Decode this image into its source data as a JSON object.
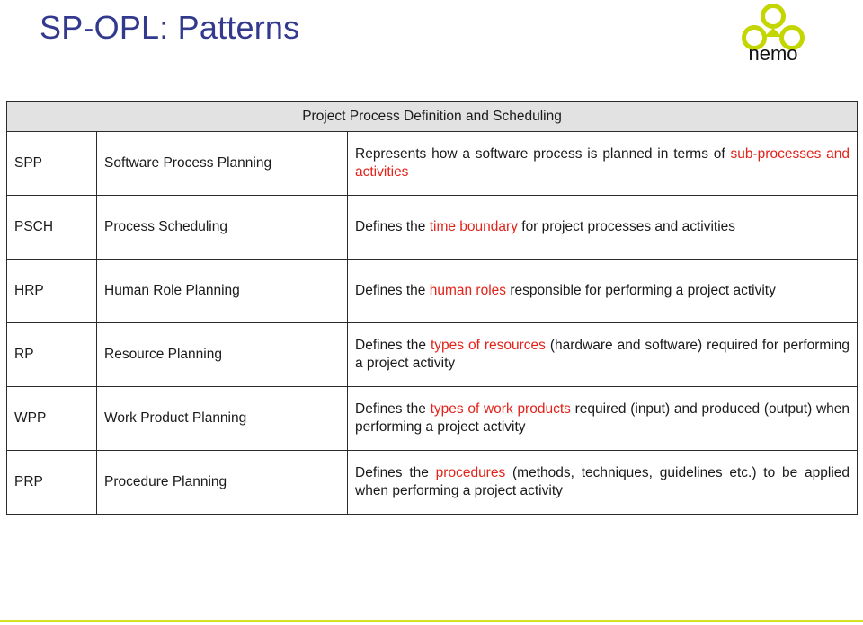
{
  "slide": {
    "title": "SP-OPL: Patterns",
    "title_color": "#333a8e",
    "accent_color": "#d7e021",
    "highlight_color": "#e2231a",
    "bottom_rule_color": "#d7e021"
  },
  "logo": {
    "name": "nemo",
    "wordmark": "nemo",
    "mark_color": "#c3d600",
    "wordmark_color": "#111111"
  },
  "table": {
    "header": "Project Process Definition and Scheduling",
    "header_bg": "#e2e2e2",
    "rows": [
      {
        "abbr": "SPP",
        "name": "Software Process Planning",
        "desc_parts": [
          {
            "text": "Represents how a software process is planned in terms of ",
            "highlight": false
          },
          {
            "text": "sub-processes and activities",
            "highlight": true
          }
        ],
        "desc_plain": "Represents how a software process is planned in terms of sub-processes and activities"
      },
      {
        "abbr": "PSCH",
        "name": "Process Scheduling",
        "desc_parts": [
          {
            "text": "Defines the ",
            "highlight": false
          },
          {
            "text": "time boundary",
            "highlight": true
          },
          {
            "text": " for project processes and activities",
            "highlight": false
          }
        ],
        "desc_plain": "Defines the time boundary for project processes and activities"
      },
      {
        "abbr": "HRP",
        "name": "Human Role Planning",
        "desc_parts": [
          {
            "text": "Defines the ",
            "highlight": false
          },
          {
            "text": "human roles",
            "highlight": true
          },
          {
            "text": " responsible for performing a project activity",
            "highlight": false
          }
        ],
        "desc_plain": "Defines the human roles responsible for performing a project activity"
      },
      {
        "abbr": "RP",
        "name": "Resource Planning",
        "desc_parts": [
          {
            "text": "Defines the ",
            "highlight": false
          },
          {
            "text": "types of resources",
            "highlight": true
          },
          {
            "text": " (hardware and software) required for performing a project activity",
            "highlight": false
          }
        ],
        "desc_plain": "Defines the types of resources (hardware and software) required for performing a project activity"
      },
      {
        "abbr": "WPP",
        "name": "Work Product Planning",
        "desc_parts": [
          {
            "text": "Defines the ",
            "highlight": false
          },
          {
            "text": "types of work products",
            "highlight": true
          },
          {
            "text": " required (input) and produced (output) when performing a project activity",
            "highlight": false
          }
        ],
        "desc_plain": "Defines the types of work products required (input) and produced (output) when performing a project activity"
      },
      {
        "abbr": "PRP",
        "name": "Procedure Planning",
        "desc_parts": [
          {
            "text": "Defines the ",
            "highlight": false
          },
          {
            "text": "procedures",
            "highlight": true
          },
          {
            "text": " (methods, techniques, guidelines etc.) to be applied when performing a project activity",
            "highlight": false
          }
        ],
        "desc_plain": "Defines the procedures (methods, techniques, guidelines etc.) to be applied when performing a project activity"
      }
    ]
  }
}
